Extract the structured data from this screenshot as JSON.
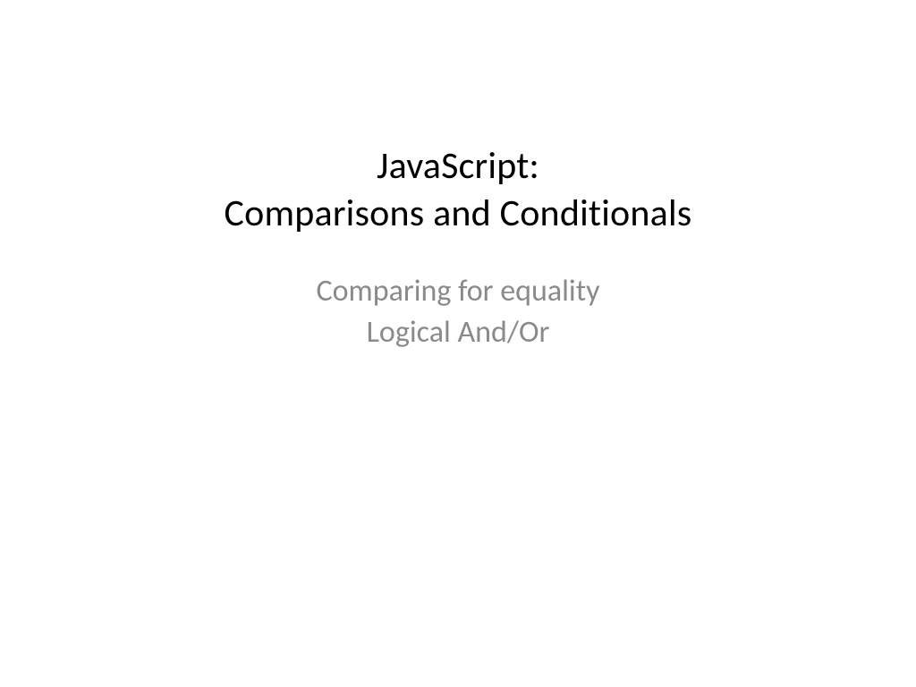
{
  "slide": {
    "title_line1": "JavaScript:",
    "title_line2": "Comparisons and Conditionals",
    "subtitle_line1": "Comparing for equality",
    "subtitle_line2": "Logical And/Or"
  }
}
